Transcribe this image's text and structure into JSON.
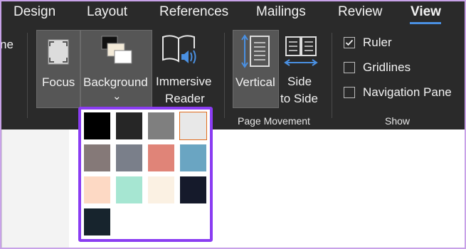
{
  "tabs": [
    {
      "label": "Design",
      "active": false
    },
    {
      "label": "Layout",
      "active": false
    },
    {
      "label": "References",
      "active": false
    },
    {
      "label": "Mailings",
      "active": false
    },
    {
      "label": "Review",
      "active": false
    },
    {
      "label": "View",
      "active": true
    }
  ],
  "ribbon": {
    "cut_label": "ne",
    "focus_label": "Focus",
    "background_label": "Background",
    "background_caret": "⌄",
    "immersive_line1": "Immersive",
    "immersive_line2": "Reader",
    "vertical_label": "Vertical",
    "side_line1": "Side",
    "side_line2": "to Side",
    "page_movement_group": "Page Movement",
    "show_group": "Show",
    "checkboxes": [
      {
        "label": "Ruler",
        "checked": true
      },
      {
        "label": "Gridlines",
        "checked": false
      },
      {
        "label": "Navigation Pane",
        "checked": false
      }
    ]
  },
  "palette": {
    "swatches": [
      {
        "name": "black",
        "color": "#000000",
        "selected": false
      },
      {
        "name": "dark-gray",
        "color": "#262626",
        "selected": false
      },
      {
        "name": "gray",
        "color": "#7f7f7f",
        "selected": false
      },
      {
        "name": "light-gray",
        "color": "#e8e8e8",
        "selected": true
      },
      {
        "name": "taupe",
        "color": "#857978",
        "selected": false
      },
      {
        "name": "slate",
        "color": "#7a7f8a",
        "selected": false
      },
      {
        "name": "salmon",
        "color": "#e08478",
        "selected": false
      },
      {
        "name": "steel-blue",
        "color": "#6aa5c2",
        "selected": false
      },
      {
        "name": "peach",
        "color": "#fdd9c4",
        "selected": false
      },
      {
        "name": "mint",
        "color": "#a6e6d2",
        "selected": false
      },
      {
        "name": "cream",
        "color": "#fbf1e3",
        "selected": false
      },
      {
        "name": "navy-black",
        "color": "#151a2b",
        "selected": false
      },
      {
        "name": "dark-teal",
        "color": "#17242d",
        "selected": false
      }
    ]
  },
  "colors": {
    "tab_underline": "#4a90e2",
    "palette_border": "#8a3cf2",
    "selected_outline": "#e06a1b",
    "ribbon_bg": "#2a2a2a"
  }
}
